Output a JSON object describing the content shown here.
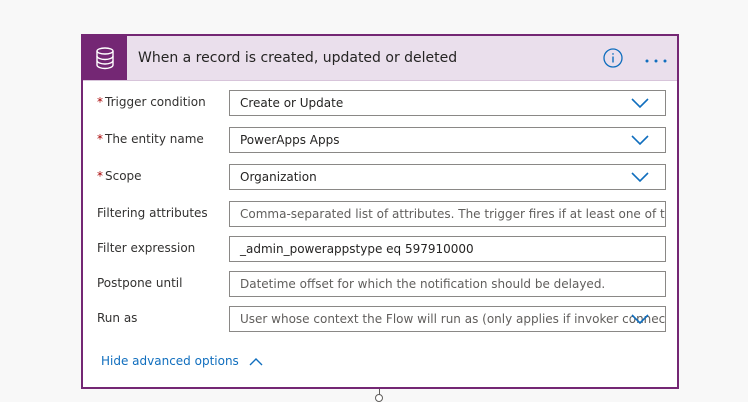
{
  "card": {
    "title": "When a record is created, updated or deleted",
    "header_icon": "database-icon",
    "info_icon": "info-icon",
    "more_icon": "more-options-icon",
    "accent_color": "#742774",
    "header_bg": "#eadfec"
  },
  "fields": [
    {
      "label": "Trigger condition",
      "required": true,
      "value": "Create or Update",
      "type": "dropdown"
    },
    {
      "label": "The entity name",
      "required": true,
      "value": "PowerApps Apps",
      "type": "dropdown"
    },
    {
      "label": "Scope",
      "required": true,
      "value": "Organization",
      "type": "dropdown"
    },
    {
      "label": "Filtering attributes",
      "required": false,
      "placeholder": "Comma-separated list of attributes. The trigger fires if at least one of these attr",
      "type": "text"
    },
    {
      "label": "Filter expression",
      "required": false,
      "value": "_admin_powerappstype eq 597910000",
      "type": "text"
    },
    {
      "label": "Postpone until",
      "required": false,
      "placeholder": "Datetime offset for which the notification should be delayed.",
      "type": "text"
    },
    {
      "label": "Run as",
      "required": false,
      "placeholder": "User whose context the Flow will run as (only applies if invoker connectic",
      "type": "dropdown"
    }
  ],
  "required_marker": "*",
  "advanced": {
    "label": "Hide advanced options",
    "icon": "chevron-up-icon"
  }
}
